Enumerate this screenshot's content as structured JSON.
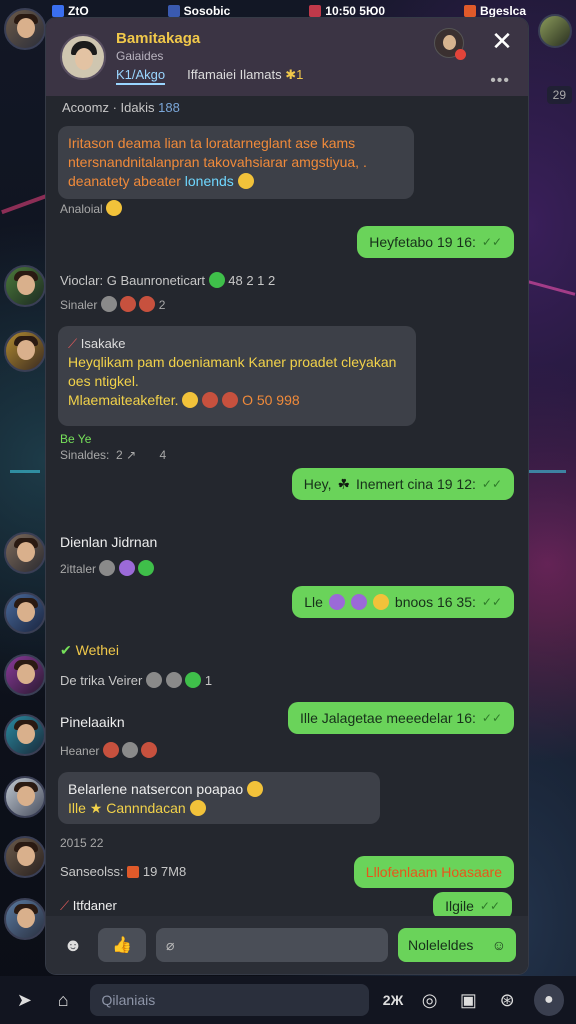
{
  "status_bar": {
    "left": "ZtO",
    "item2": "Sosobic",
    "time": "10:50 5Ю0",
    "item4": "Bgeslca"
  },
  "header": {
    "title": "Bamitakaga",
    "subtitle": "Gaiaides",
    "tab_active": "K1/Akgo",
    "tab2": "Iffamaiei Ilamats",
    "tab2_suffix": "✱1"
  },
  "right_badge": "29",
  "messages": {
    "m1_sender": "Acoomz · Idakis",
    "m1_sender_suffix": "188",
    "m1_line1": "Iritason deama lian ta loratarneglant ase kams",
    "m1_line2": "ntersnandnitalanpran takovahsiarar amgstiyua, .",
    "m1_line3": "deanatety abeater",
    "m1_line3_cyan": "lonends",
    "m1_footer": "Analoial",
    "m2_out": "Heyfetabo 19 16:",
    "m3_name": "Vioclar: G Baunroneticart",
    "m3_name_suffix": "48 2 1 2",
    "m3_sub": "Sinaler",
    "m3_sub_num": "2",
    "m4_reply_name": "Isakake",
    "m4_line1": "Heyqlikam pam doeniamank Kaner proadet cleyakan",
    "m4_line2": "oes ntigkel.",
    "m4_line3": "Mlaemaiteakefter.",
    "m4_line3_suffix": "O 50 998",
    "m4_after_label": "Be Ye",
    "m4_after_sub": "Sinaldes:",
    "m4_after_num1": "2",
    "m4_after_num2": "4",
    "m5_out_a": "Hey,",
    "m5_out_b": "Inemert cina 19 12:",
    "m6_name": "Dienlan Jidrnan",
    "m6_sub": "2ittaler",
    "m7_out_a": "Lle",
    "m7_out_b": "bnoos 16 35:",
    "m8_name": "Wethei",
    "m8_sub": "De trika Veirer",
    "m8_sub_num": "1",
    "m9_name": "Pinelaaikn",
    "m9_out": "Ille Jalagetae meeedelar 16:",
    "m9_sub": "Heaner",
    "m10_line1": "Belarlene natsercon poapao",
    "m10_line2_a": "Ille",
    "m10_line2_b": "Cannndacan",
    "m11_label": "2015 22",
    "m11_sub": "Sanseolss:",
    "m11_sub_num": "19 7M8",
    "m12_out": "Lllofenlaam Hoasaare",
    "m12_out2": "Ilgile",
    "m13_name": "Itfdaner"
  },
  "input": {
    "send_label": "Noleleldes"
  },
  "bottom": {
    "placeholder": "Qilaniais",
    "count": "2Ж"
  }
}
